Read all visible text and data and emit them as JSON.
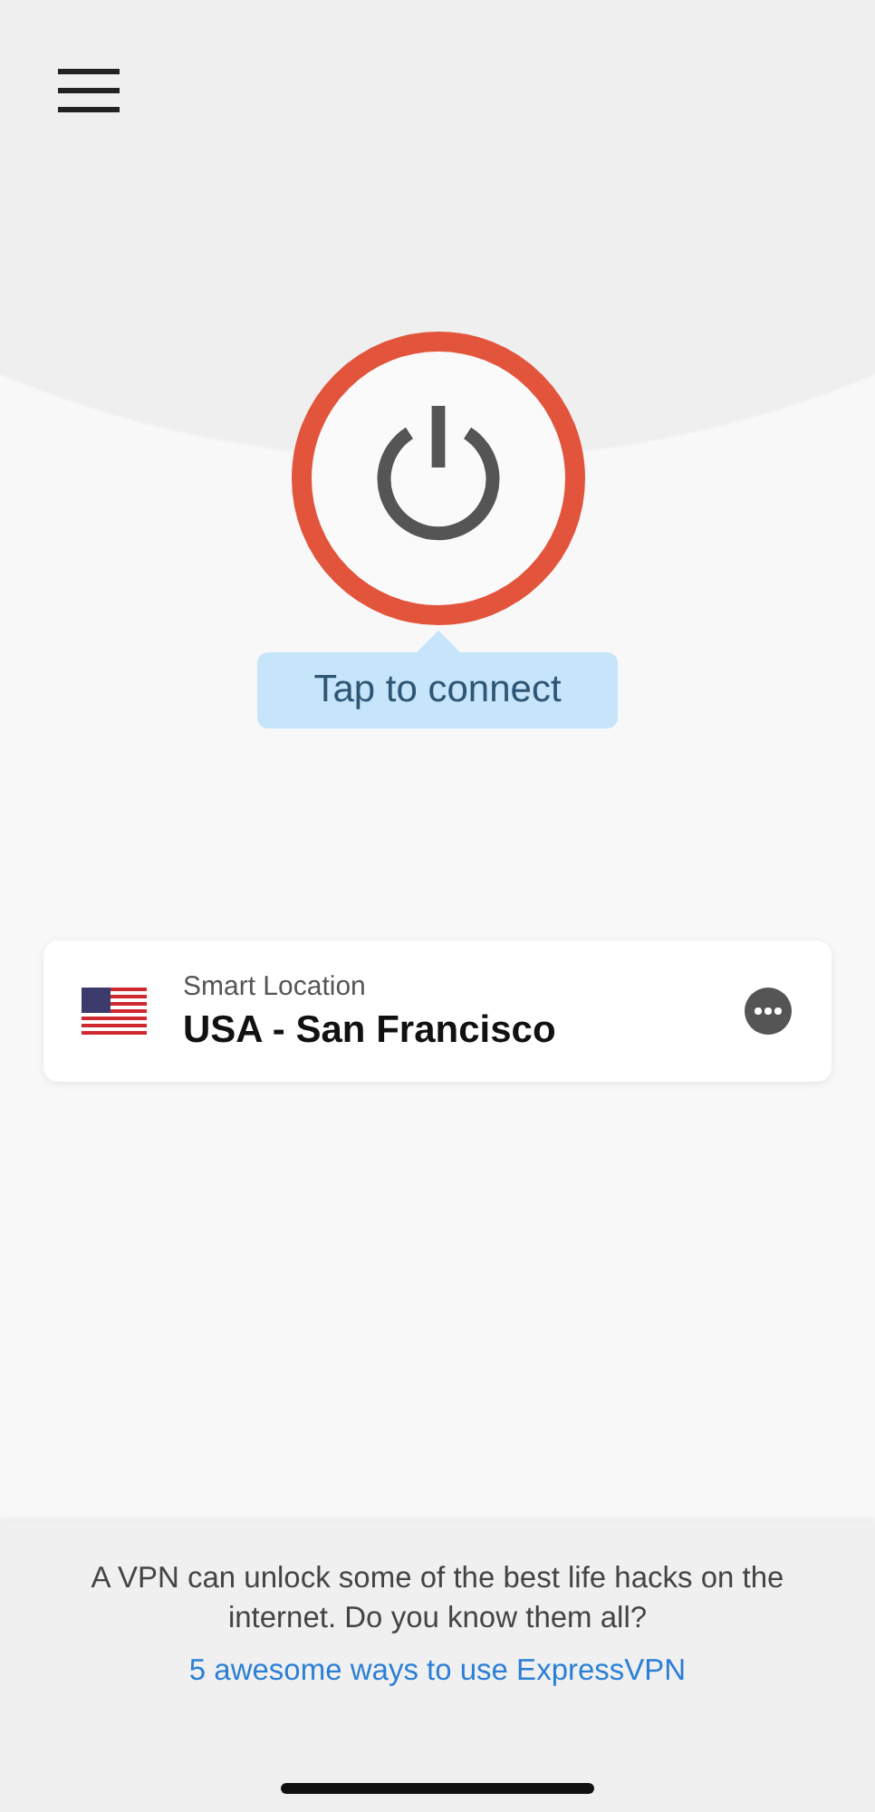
{
  "connection": {
    "connected": false,
    "hint": "Tap to connect"
  },
  "location": {
    "label": "Smart Location",
    "name": "USA - San Francisco"
  },
  "footer": {
    "message": "A VPN can unlock some of the best life hacks on the internet. Do you know them all?",
    "link": "5 awesome ways to use ExpressVPN"
  }
}
